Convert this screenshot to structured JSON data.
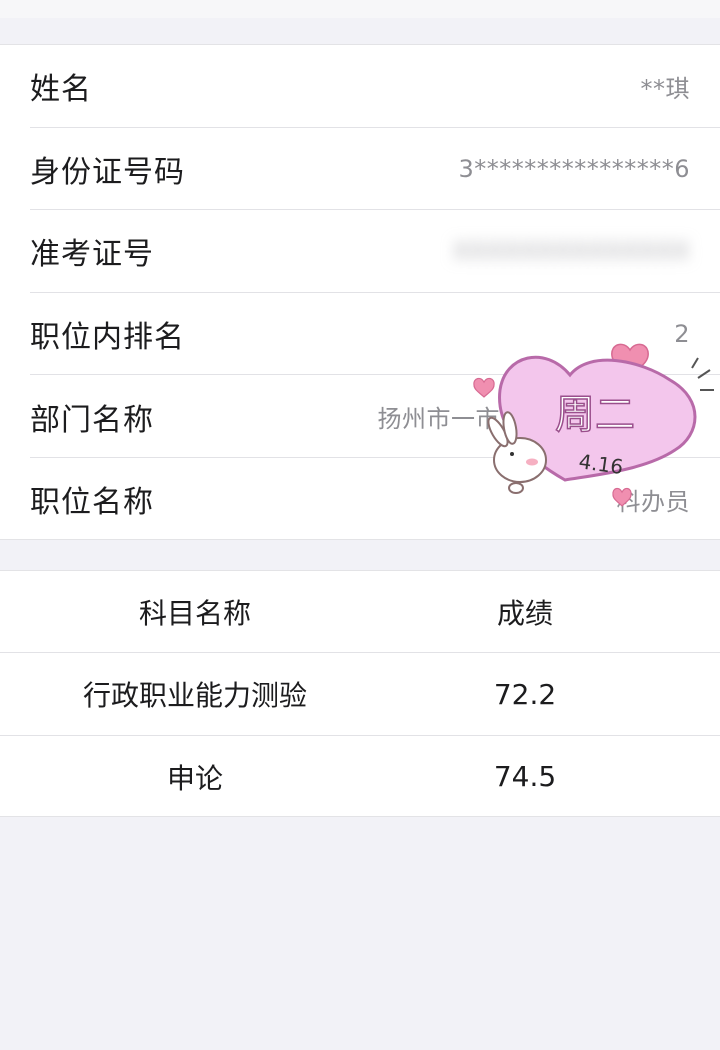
{
  "info": {
    "rows": [
      {
        "label": "姓名",
        "value": "**琪"
      },
      {
        "label": "身份证号码",
        "value": "3****************6"
      },
      {
        "label": "准考证号",
        "value": "XXXXXXXXXXXXXX"
      },
      {
        "label": "职位内排名",
        "value": "2"
      },
      {
        "label": "部门名称",
        "value": "扬州市一市"
      },
      {
        "label": "职位名称",
        "value": "科办员"
      }
    ]
  },
  "scores": {
    "header": {
      "subject": "科目名称",
      "score": "成绩"
    },
    "rows": [
      {
        "subject": "行政职业能力测验",
        "score": "72.2"
      },
      {
        "subject": "申论",
        "score": "74.5"
      }
    ]
  },
  "sticker": {
    "weekday": "周二",
    "date": "4.16",
    "heart_color": "#f3c6ec",
    "outline_color": "#e8a0d8"
  }
}
